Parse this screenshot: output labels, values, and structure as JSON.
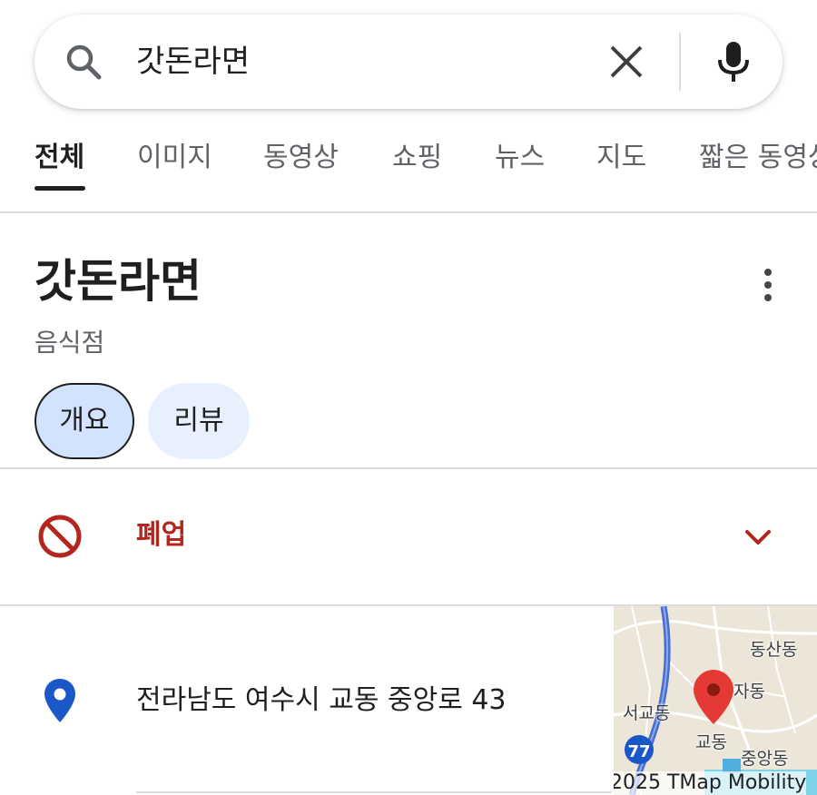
{
  "search": {
    "query": "갓돈라면"
  },
  "tabs": [
    {
      "label": "전체",
      "active": true
    },
    {
      "label": "이미지"
    },
    {
      "label": "동영상"
    },
    {
      "label": "쇼핑"
    },
    {
      "label": "뉴스"
    },
    {
      "label": "지도"
    },
    {
      "label": "짧은 동영상"
    }
  ],
  "place": {
    "title": "갓돈라면",
    "category": "음식점",
    "chips": [
      "개요",
      "리뷰"
    ],
    "status": "폐업",
    "address": "전라남도 여수시 교동 중앙로 43"
  },
  "map": {
    "labels": [
      "동산동",
      "자동",
      "서교동",
      "교동",
      "중앙동"
    ],
    "route_badge": "77",
    "credit": "2025 TMap Mobility"
  },
  "colors": {
    "closed_red": "#b3261e",
    "pin_blue": "#1a57c7",
    "chip_active": "#d3e3fd",
    "chip_normal": "#e8f0fe",
    "map_pin_red": "#e53935"
  }
}
